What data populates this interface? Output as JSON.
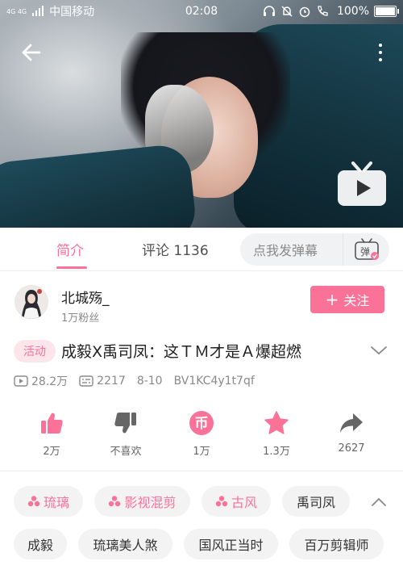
{
  "status_bar": {
    "network": "4G 4G",
    "carrier": "中国移动",
    "time": "02:08",
    "battery": "100%",
    "battery_level": 1.0
  },
  "player": {
    "back_icon": "arrow-left-icon",
    "more_icon": "more-vertical-icon",
    "play_icon": "tv-play-icon"
  },
  "tabs": [
    {
      "label": "简介",
      "active": true
    },
    {
      "label": "评论 1136",
      "active": false
    }
  ],
  "danmaku": {
    "placeholder": "点我发弹幕",
    "icon_label": "弹"
  },
  "uploader": {
    "name": "北城殇_",
    "fans": "1万粉丝",
    "follow_label": "关注"
  },
  "video": {
    "activity_tag": "活动",
    "title": "成毅X禹司凤：这ＴＭ才是Ａ爆超燃",
    "views": "28.2万",
    "danmaku_count": "2217",
    "date": "8-10",
    "bvid": "BV1KC4y1t7qf"
  },
  "actions": [
    {
      "name": "like",
      "icon": "thumb-up-icon",
      "label": "2万"
    },
    {
      "name": "dislike",
      "icon": "thumb-down-icon",
      "label": "不喜欢"
    },
    {
      "name": "coin",
      "icon": "coin-icon",
      "label": "1万"
    },
    {
      "name": "favorite",
      "icon": "star-icon",
      "label": "1.3万"
    },
    {
      "name": "share",
      "icon": "share-icon",
      "label": "2627"
    }
  ],
  "tags": {
    "row1": [
      {
        "label": "琉璃",
        "channel": true
      },
      {
        "label": "影视混剪",
        "channel": true
      },
      {
        "label": "古风",
        "channel": true
      },
      {
        "label": "禹司凤",
        "channel": false
      }
    ],
    "row2": [
      {
        "label": "成毅",
        "channel": false
      },
      {
        "label": "琉璃美人煞",
        "channel": false
      },
      {
        "label": "国风正当时",
        "channel": false
      },
      {
        "label": "百万剪辑师",
        "channel": false
      }
    ]
  },
  "colors": {
    "accent": "#fb7299",
    "text": "#212121",
    "muted": "#8a8a8a"
  }
}
